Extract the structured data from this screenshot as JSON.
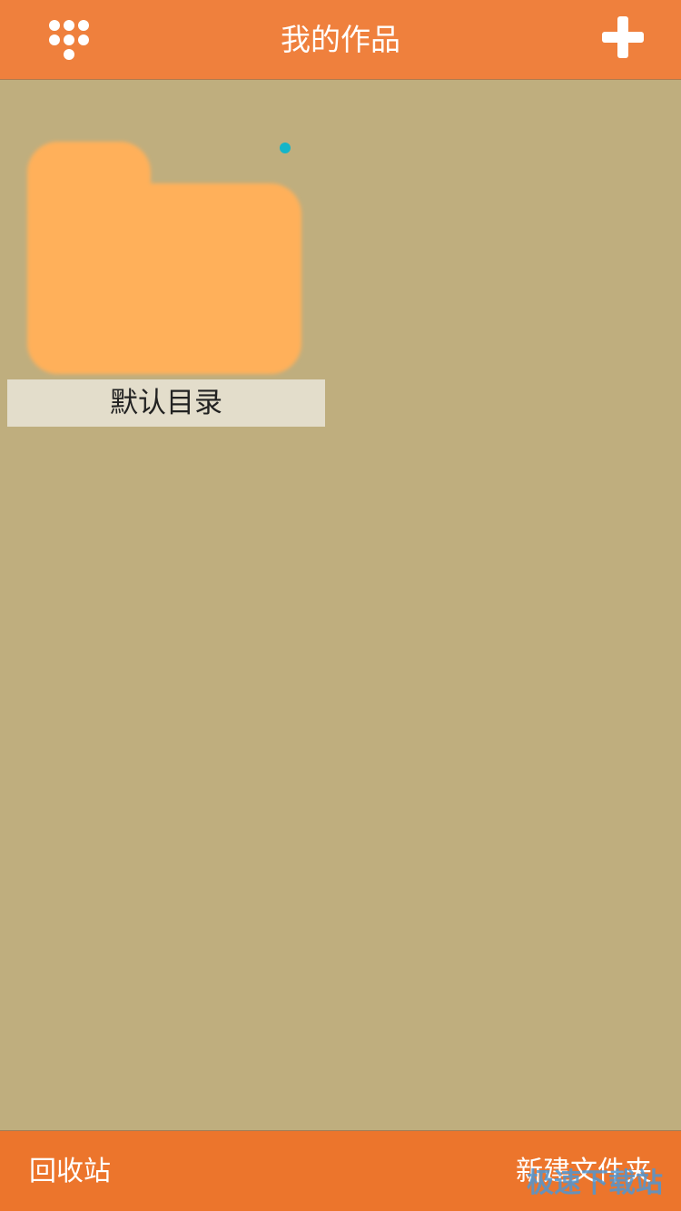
{
  "header": {
    "title": "我的作品",
    "menu_icon": "menu-dots-icon",
    "add_icon": "plus-icon"
  },
  "folders": [
    {
      "label": "默认目录",
      "icon": "folder-icon",
      "has_badge": true
    }
  ],
  "footer": {
    "recycle_label": "回收站",
    "new_folder_label": "新建文件夹"
  },
  "watermark": "极速下载站",
  "colors": {
    "header_bg": "#ef803d",
    "footer_bg": "#ec752c",
    "content_bg": "#bfae7e",
    "folder_fill": "#ffb05a",
    "label_bg": "#e3ddcb",
    "badge": "#15b5c9"
  }
}
